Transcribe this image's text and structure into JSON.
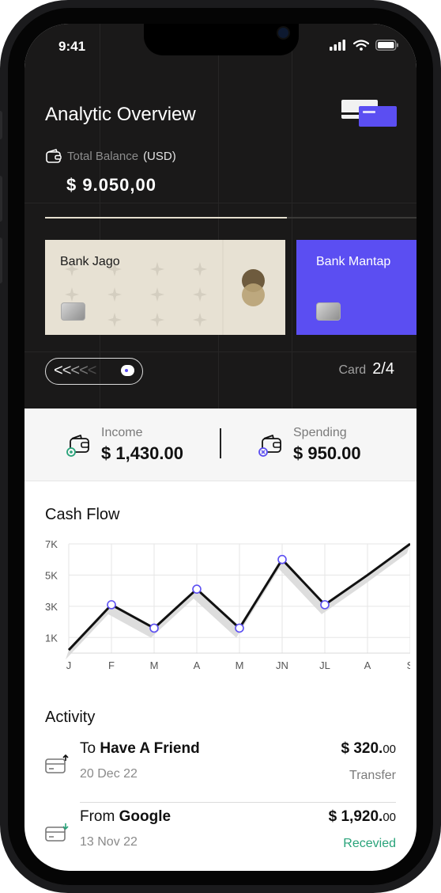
{
  "status_bar": {
    "time": "9:41"
  },
  "header": {
    "title": "Analytic Overview"
  },
  "balance": {
    "label": "Total Balance",
    "currency": "(USD)",
    "value": "$ 9.050,00"
  },
  "cards": [
    {
      "name": "Bank Jago",
      "color": "#e7e1d3"
    },
    {
      "name": "Bank Mantap",
      "color": "#5b4ef2"
    }
  ],
  "pager": {
    "arrows": "<<<<<",
    "card_label": "Card",
    "card_count": "2/4",
    "progress": 0.65
  },
  "summary": {
    "income": {
      "label": "Income",
      "value": "$ 1,430.00"
    },
    "spending": {
      "label": "Spending",
      "value": "$ 950.00"
    }
  },
  "cash_flow": {
    "title": "Cash Flow"
  },
  "chart_data": {
    "type": "line",
    "categories": [
      "J",
      "F",
      "M",
      "A",
      "M",
      "JN",
      "JL",
      "A",
      "S"
    ],
    "values": [
      0.2,
      3.1,
      1.6,
      4.1,
      1.6,
      6.0,
      3.1,
      5.0,
      7.0
    ],
    "y_ticks": [
      "7K",
      "5K",
      "3K",
      "1K"
    ],
    "ylim": [
      0,
      7
    ],
    "grid": true,
    "marked_points": [
      1,
      2,
      3,
      4,
      5,
      6
    ],
    "line_color": "#111111",
    "marker_color": "#5b4ef2"
  },
  "activity": {
    "title": "Activity",
    "items": [
      {
        "prefix": "To",
        "name": "Have A Friend",
        "date": "20 Dec 22",
        "amount_main": "$ 320.",
        "amount_cents": "00",
        "type": "Transfer",
        "type_color": "#7a7a7a"
      },
      {
        "prefix": "From",
        "name": "Google",
        "date": "13 Nov 22",
        "amount_main": "$ 1,920.",
        "amount_cents": "00",
        "type": "Recevied",
        "type_color": "#29a37a"
      }
    ]
  }
}
